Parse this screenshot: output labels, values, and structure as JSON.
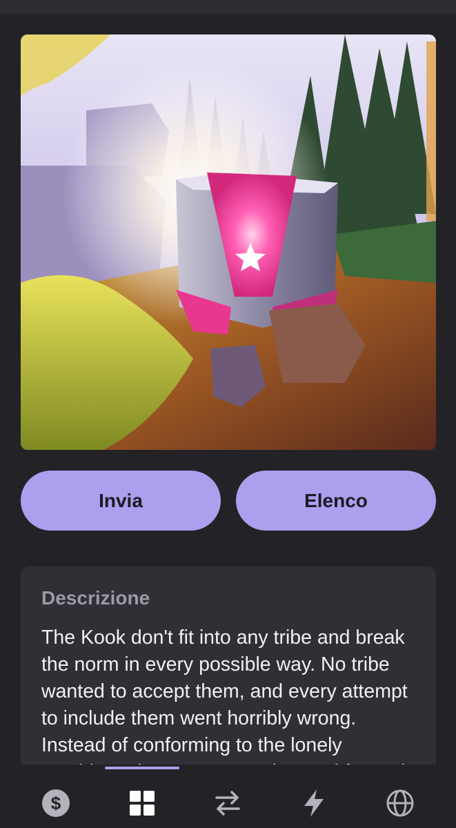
{
  "actions": {
    "send_label": "Invia",
    "list_label": "Elenco"
  },
  "description": {
    "title": "Descrizione",
    "text": "The Kook don't fit into any tribe and break the norm in every possible way. No tribe wanted to accept them, and every attempt to include them went horribly wrong. Instead of conforming to the lonely outsiders, they came together and formed their"
  },
  "hero": {
    "icon": "star-icon"
  },
  "bottom_nav": {
    "items": [
      {
        "name": "currency",
        "icon": "dollar-coin-icon",
        "active": false
      },
      {
        "name": "collection",
        "icon": "grid-icon",
        "active": true
      },
      {
        "name": "transfer",
        "icon": "swap-arrows-icon",
        "active": false
      },
      {
        "name": "activity",
        "icon": "lightning-icon",
        "active": false
      },
      {
        "name": "web",
        "icon": "globe-icon",
        "active": false
      }
    ]
  },
  "colors": {
    "background": "#232226",
    "accent": "#ab9fee",
    "card": "#2f2f35",
    "chest_pink": "#e8378f"
  }
}
